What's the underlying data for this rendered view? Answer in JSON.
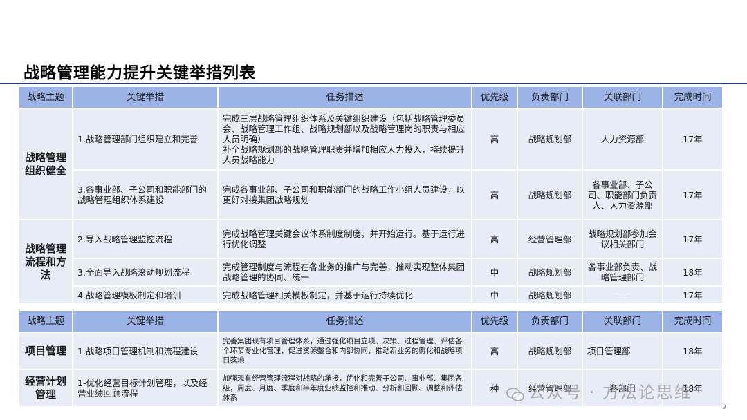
{
  "title": "战略管理能力提升关键举措列表",
  "table1": {
    "headers": [
      "战略主题",
      "关键举措",
      "任务描述",
      "优先级",
      "负责部门",
      "关联部门",
      "完成时间"
    ],
    "themes": [
      "战略管理组织健全",
      "战略管理流程和方法"
    ],
    "rows": [
      {
        "measure": "1.战略管理部门组织建立和完善",
        "desc": "完成三层战略管理组织体系及关键组织建设（包括战略管理委员会、战略管理工作组、战略规划部以及战略管理岗的职责与相应人员明确）\n补全战略规划部的战略管理职责并增加相应人力投入，持续提升人员战略能力",
        "priority": "高",
        "owner": "战略规划部",
        "related": "人力资源部",
        "due": "17年"
      },
      {
        "measure": "3.各事业部、子公司和职能部门的战略管理组织体系建设",
        "desc": "完成各事业部、子公司和职能部门的战略工作小组人员建设，以更好对接集团战略规划",
        "priority": "高",
        "owner": "战略规划部",
        "related": "各事业部、子公司、职能部门负责人、人力资源部",
        "due": "17年"
      },
      {
        "measure": "2.导入战略管理监控流程",
        "desc": "完成战略管理关键会议体系制度制度，并开始运行。基于运行进行优化调整",
        "priority": "高",
        "owner": "经营管理部",
        "related": "战略规划部参加会议相关部门",
        "due": "17年"
      },
      {
        "measure": "3.全面导入战略滚动规划流程",
        "desc": "完成管理制度与流程在各业务的推广与完善，推动实现整体集团战略管理的协同、统一",
        "priority": "中",
        "owner": "战略规划部",
        "related": "各事业部负责、战略管理部门",
        "due": "18年"
      },
      {
        "measure": "4.战略管理模板制定和培训",
        "desc": "完成战略管理相关模板制定，并基于运行持续优化",
        "priority": "中",
        "owner": "战略规划部",
        "related": "——",
        "due": "17年"
      }
    ]
  },
  "table2": {
    "headers": [
      "战略主题",
      "关键举措",
      "任务描述",
      "优先级",
      "负责部门",
      "关联部门",
      "完成时间"
    ],
    "rows": [
      {
        "theme": "项目管理",
        "measure": "1.战略项目管理机制和流程建设",
        "desc": "完善集团现有项目管理体系，通过强化项目立项、决策、过程管理、评估各个环节专业化管理，促进资源整合和内部协同，推动新业务的孵化和战略项目落地",
        "priority": "高",
        "owner": "战略规划部",
        "related": "项目管理部",
        "due": "18年"
      },
      {
        "theme": "经营计划管理",
        "measure": "1-优化经营目标计划管理，以及经营业绩回顾流程",
        "desc": "加强现有经营管理流程对战略的承接，优化和完善子公司、事业部、集团各级，周度、月度、季度和半年度业绩监控和推动、分析和回顾、调整和评估体系",
        "priority": "种",
        "owner": "经营管理部",
        "related": "各部门",
        "due": "18年"
      }
    ]
  },
  "watermark": "公众号 · 方法论思维",
  "page_number": "9"
}
